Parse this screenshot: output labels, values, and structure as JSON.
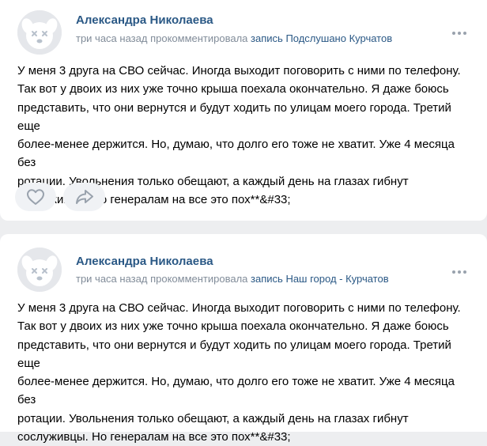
{
  "posts": [
    {
      "author": "Александра Николаева",
      "time": "три часа назад",
      "action": "прокомментировала",
      "target_prefix": "запись",
      "target": "Подслушано Курчатов",
      "text": "У меня 3 друга на СВО сейчас. Иногда выходит поговорить с ними по телефону.\nТак вот у двоих из них уже точно крыша поехала окончательно. Я даже боюсь\nпредставить, что они вернутся и будут ходить по улицам моего города. Третий еще\nболее-менее держится. Но, думаю, что долго его тоже не хватит. Уже 4 месяца без\nротации. Увольнения только обещают, а каждый день на глазах гибнут\nсослуживцы. Но генералам на все это пох**&#33;",
      "like_icon": "heart-icon",
      "share_icon": "share-arrow-icon",
      "more_icon": "more-dots-icon"
    },
    {
      "author": "Александра Николаева",
      "time": "три часа назад",
      "action": "прокомментировала",
      "target_prefix": "запись",
      "target": "Наш город - Курчатов",
      "text": "У меня 3 друга на СВО сейчас. Иногда выходит поговорить с ними по телефону.\nТак вот у двоих из них уже точно крыша поехала окончательно. Я даже боюсь\nпредставить, что они вернутся и будут ходить по улицам моего города. Третий еще\nболее-менее держится. Но, думаю, что долго его тоже не хватит. Уже 4 месяца без\nротации. Увольнения только обещают, а каждый день на глазах гибнут\nсослуживцы. Но генералам на все это пох**&#33;",
      "more_icon": "more-dots-icon"
    }
  ],
  "colors": {
    "background": "#edeef0",
    "card": "#ffffff",
    "link": "#2a5885",
    "meta": "#818c99",
    "icon": "#99a2ad",
    "button_bg": "#f0f2f5"
  }
}
